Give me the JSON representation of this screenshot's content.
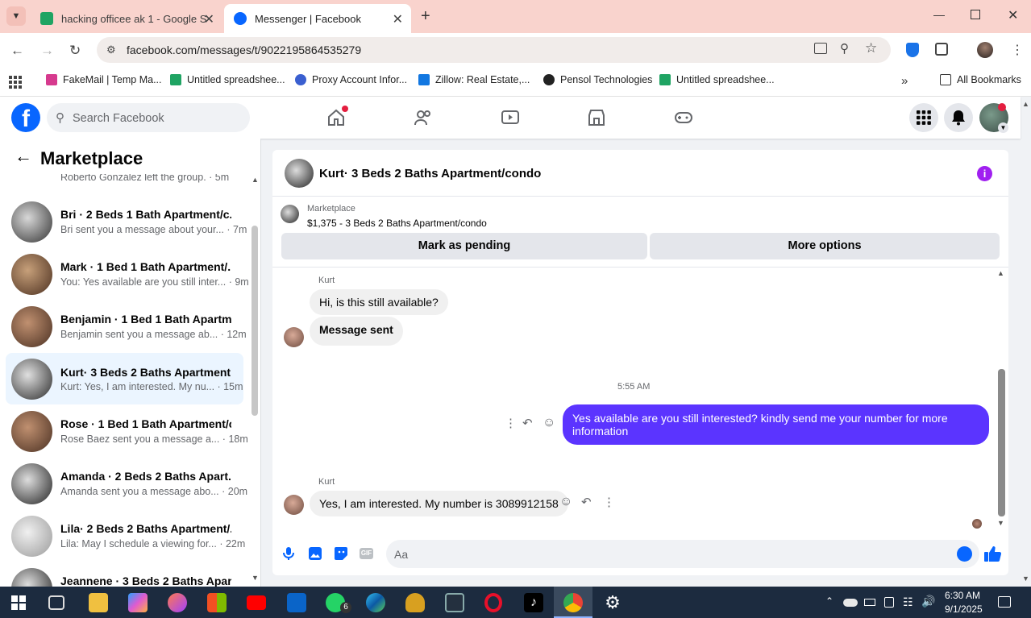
{
  "browser": {
    "tabs": [
      {
        "title": "hacking officee ak 1 - Google Sh"
      },
      {
        "title": "Messenger | Facebook"
      }
    ],
    "url": "facebook.com/messages/t/9022195864535279",
    "bookmarks": [
      {
        "label": "FakeMail | Temp Ma...",
        "icon": "fakemail-icon"
      },
      {
        "label": "Untitled spreadshee...",
        "icon": "sheets-icon"
      },
      {
        "label": "Proxy Account Infor...",
        "icon": "proxy-icon"
      },
      {
        "label": "Zillow: Real Estate,...",
        "icon": "zillow-icon"
      },
      {
        "label": "Pensol Technologies",
        "icon": "pensol-icon"
      },
      {
        "label": "Untitled spreadshee...",
        "icon": "sheets-icon"
      }
    ],
    "all_bookmarks": "All Bookmarks"
  },
  "facebook": {
    "search_placeholder": "Search Facebook"
  },
  "sidebar": {
    "title": "Marketplace",
    "conversations": [
      {
        "title": "",
        "snippet": "Roberto González left the group. · 5m"
      },
      {
        "title": "Bri · 2 Beds 1 Bath Apartment/c...",
        "snippet": "Bri sent you a message about your... · 7m"
      },
      {
        "title": "Mark · 1 Bed 1 Bath Apartment/...",
        "snippet": "You: Yes available are you still inter... · 9m"
      },
      {
        "title": "Benjamin · 1 Bed 1 Bath Apartm...",
        "snippet": "Benjamin sent you a message ab... · 12m"
      },
      {
        "title": "Kurt· 3 Beds 2 Baths Apartment...",
        "snippet": "Kurt: Yes, I am interested. My nu... · 15m"
      },
      {
        "title": "Rose · 1 Bed 1 Bath Apartment/c...",
        "snippet": "Rose Baez sent you a message a... · 18m"
      },
      {
        "title": "Amanda · 2 Beds 2 Baths Apart...",
        "snippet": "Amanda sent you a message abo... · 20m"
      },
      {
        "title": "Lila· 2 Beds 2 Baths Apartment/...",
        "snippet": "Lila: May I schedule a viewing for... · 22m"
      },
      {
        "title": "Jeannene · 3 Beds 2 Baths Apart...",
        "snippet": ""
      }
    ]
  },
  "chat": {
    "title": "Kurt· 3 Beds 2 Baths Apartment/condo",
    "listing_label": "Marketplace",
    "listing_desc": "$1,375 - 3 Beds 2 Baths Apartment/condo",
    "mark_pending": "Mark as pending",
    "more_options": "More options",
    "sender_name": "Kurt",
    "msg1": "Hi, is this still available?",
    "msg2": "Message sent",
    "time": "5:55 AM",
    "msg3": "Yes available are you still interested? kindly send me your number for more information",
    "msg4": "Yes, I am interested. My number is 3089912158",
    "input_placeholder": "Aa"
  },
  "taskbar": {
    "time": "6:30 AM",
    "date": "9/1/2025",
    "whatsapp_badge": "6"
  }
}
